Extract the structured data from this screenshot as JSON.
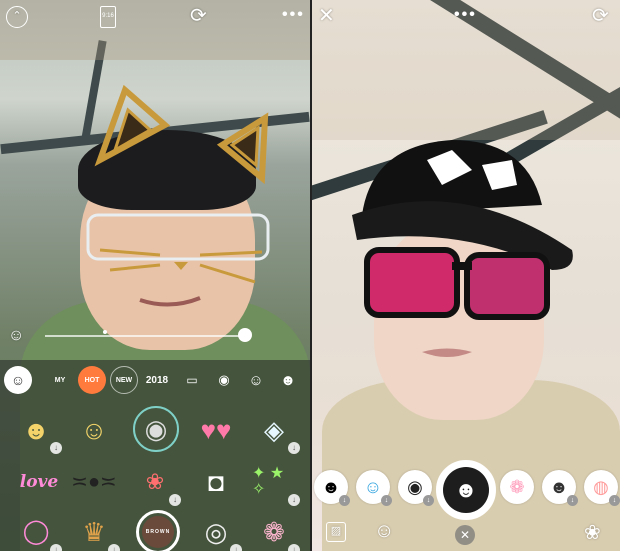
{
  "left_panel": {
    "top_bar": {
      "ratio_label": "9:16"
    },
    "categories": [
      {
        "name": "selected-effect",
        "label": "☺"
      },
      {
        "name": "my",
        "label": "MY"
      },
      {
        "name": "hot",
        "label": "HOT"
      },
      {
        "name": "new",
        "label": "NEW"
      },
      {
        "name": "year-2018",
        "label": "2018"
      },
      {
        "name": "character-1",
        "label": ""
      },
      {
        "name": "character-2",
        "label": ""
      },
      {
        "name": "character-3",
        "label": ""
      },
      {
        "name": "character-4",
        "label": ""
      }
    ],
    "stickers_row1": [
      "emoji-pair",
      "star-face",
      "cat-face-selected",
      "hearts-eyes",
      "neon-cat"
    ],
    "stickers_row2_love_text": "love",
    "capture_brand": "BROWN",
    "colors": {
      "hot_badge": "#ff7a3d",
      "selection_ring": "#7fd1c8",
      "drawer_bg": "#2a2e2b"
    }
  },
  "right_panel": {
    "stickers": [
      "boy-face",
      "blue-bunny",
      "black-cat",
      "cap-sunglasses-selected",
      "pink-bear",
      "sunglasses-face",
      "pink-pig"
    ]
  }
}
